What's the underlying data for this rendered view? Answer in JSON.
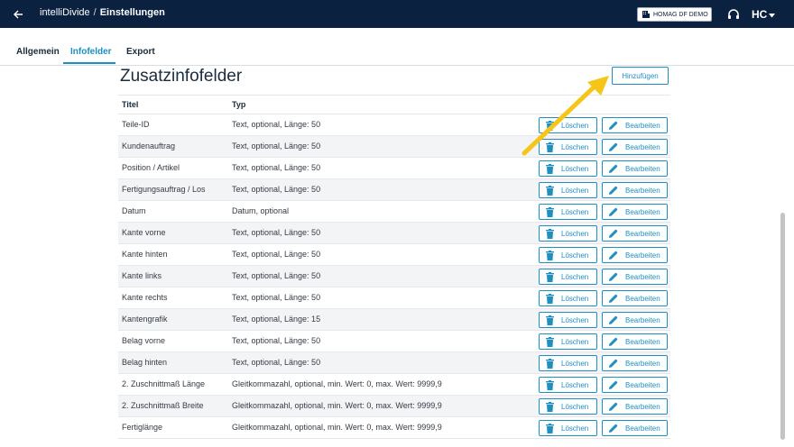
{
  "header": {
    "app_name": "intelliDivide",
    "separator": "/",
    "page": "Einstellungen",
    "tenant": "HOMAG DF DEMO",
    "user_initials": "HC",
    "colors": {
      "bar": "#0b2140",
      "accent": "#1d8fc0",
      "arrow": "#f5c518"
    }
  },
  "tabs": [
    {
      "label": "Allgemein",
      "active": false
    },
    {
      "label": "Infofelder",
      "active": true
    },
    {
      "label": "Export",
      "active": false
    }
  ],
  "main": {
    "title": "Zusatzinfofelder",
    "add_label": "Hinzufügen",
    "columns": {
      "title": "Titel",
      "type": "Typ"
    },
    "delete_label": "Löschen",
    "edit_label": "Bearbeiten",
    "rows": [
      {
        "title": "Teile-ID",
        "type": "Text, optional, Länge: 50"
      },
      {
        "title": "Kundenauftrag",
        "type": "Text, optional, Länge: 50"
      },
      {
        "title": "Position / Artikel",
        "type": "Text, optional, Länge: 50"
      },
      {
        "title": "Fertigungsauftrag / Los",
        "type": "Text, optional, Länge: 50"
      },
      {
        "title": "Datum",
        "type": "Datum, optional"
      },
      {
        "title": "Kante vorne",
        "type": "Text, optional, Länge: 50"
      },
      {
        "title": "Kante hinten",
        "type": "Text, optional, Länge: 50"
      },
      {
        "title": "Kante links",
        "type": "Text, optional, Länge: 50"
      },
      {
        "title": "Kante rechts",
        "type": "Text, optional, Länge: 50"
      },
      {
        "title": "Kantengrafik",
        "type": "Text, optional, Länge: 15"
      },
      {
        "title": "Belag vorne",
        "type": "Text, optional, Länge: 50"
      },
      {
        "title": "Belag hinten",
        "type": "Text, optional, Länge: 50"
      },
      {
        "title": "2. Zuschnittmaß Länge",
        "type": "Gleitkommazahl, optional, min. Wert: 0, max. Wert: 9999,9"
      },
      {
        "title": "2. Zuschnittmaß Breite",
        "type": "Gleitkommazahl, optional, min. Wert: 0, max. Wert: 9999,9"
      },
      {
        "title": "Fertiglänge",
        "type": "Gleitkommazahl, optional, min. Wert: 0, max. Wert: 9999,9"
      }
    ]
  }
}
